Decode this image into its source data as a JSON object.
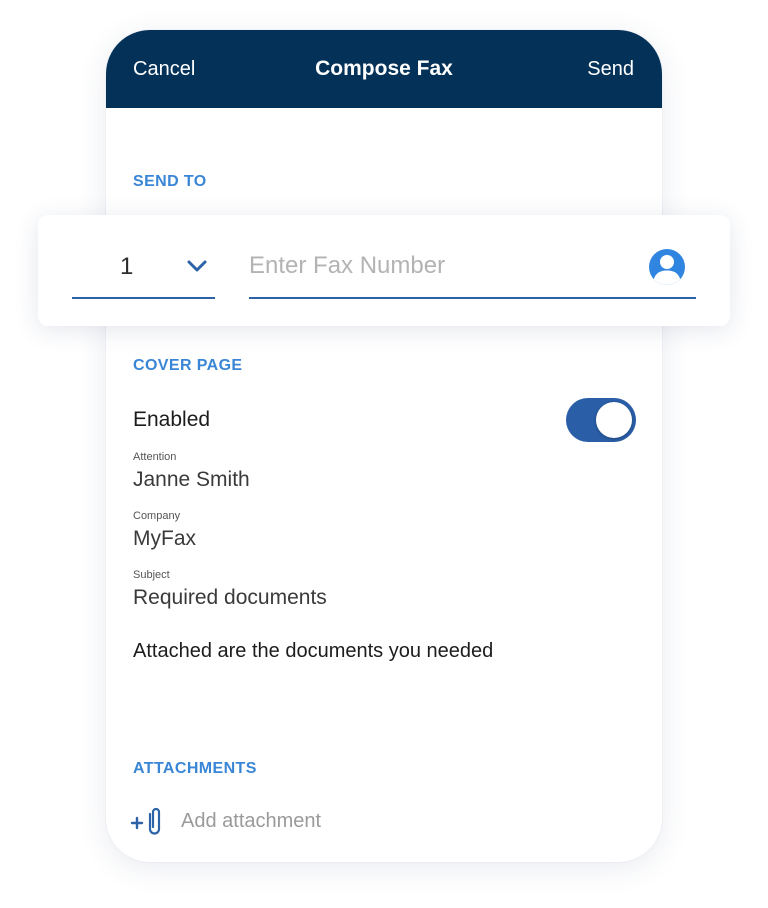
{
  "header": {
    "cancel_label": "Cancel",
    "title": "Compose Fax",
    "send_label": "Send"
  },
  "send_to": {
    "section_label": "SEND TO",
    "country_code": "1",
    "fax_placeholder": "Enter Fax Number",
    "fax_value": "",
    "contact_icon": "person-circle-icon",
    "dropdown_icon": "chevron-down-icon"
  },
  "cover_page": {
    "section_label": "COVER PAGE",
    "enabled_label": "Enabled",
    "enabled": true,
    "attention_caption": "Attention",
    "attention_value": "Janne Smith",
    "company_caption": "Company",
    "company_value": "MyFax",
    "subject_caption": "Subject",
    "subject_value": "Required documents",
    "message": "Attached are the documents you needed"
  },
  "attachments": {
    "section_label": "ATTACHMENTS",
    "add_label": "Add attachment",
    "add_icon": "paperclip-plus-icon"
  },
  "colors": {
    "header_bg": "#043158",
    "accent": "#3a86d6",
    "toggle_on": "#2a5ea6",
    "underline": "#2c63a8"
  }
}
